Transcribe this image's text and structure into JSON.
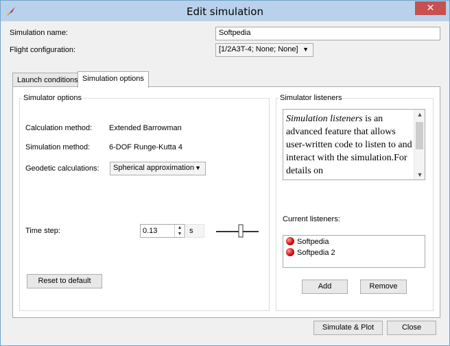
{
  "window": {
    "title": "Edit simulation",
    "close_label": "✕"
  },
  "form": {
    "name_label": "Simulation name:",
    "name_value": "Softpedia",
    "flight_label": "Flight configuration:",
    "flight_value": "[1/2A3T-4; None; None]"
  },
  "tabs": [
    {
      "label": "Launch conditions",
      "active": false
    },
    {
      "label": "Simulation options",
      "active": true
    }
  ],
  "simulator_options": {
    "title": "Simulator options",
    "calc_method_label": "Calculation method:",
    "calc_method_value": "Extended Barrowman",
    "sim_method_label": "Simulation method:",
    "sim_method_value": "6-DOF Runge-Kutta 4",
    "geodetic_label": "Geodetic calculations:",
    "geodetic_value": "Spherical approximation",
    "time_step_label": "Time step:",
    "time_step_value": "0.13",
    "time_step_unit": "s",
    "reset_label": "Reset to default"
  },
  "simulator_listeners": {
    "title": "Simulator listeners",
    "description_em": "Simulation listeners",
    "description_rest": " is an advanced feature that allows user-written code to listen to and interact with the simulation.For details on",
    "current_label": "Current listeners:",
    "items": [
      "Softpedia",
      "Softpedia 2"
    ],
    "add_label": "Add",
    "remove_label": "Remove"
  },
  "footer": {
    "simulate_label": "Simulate & Plot",
    "close_label": "Close"
  }
}
